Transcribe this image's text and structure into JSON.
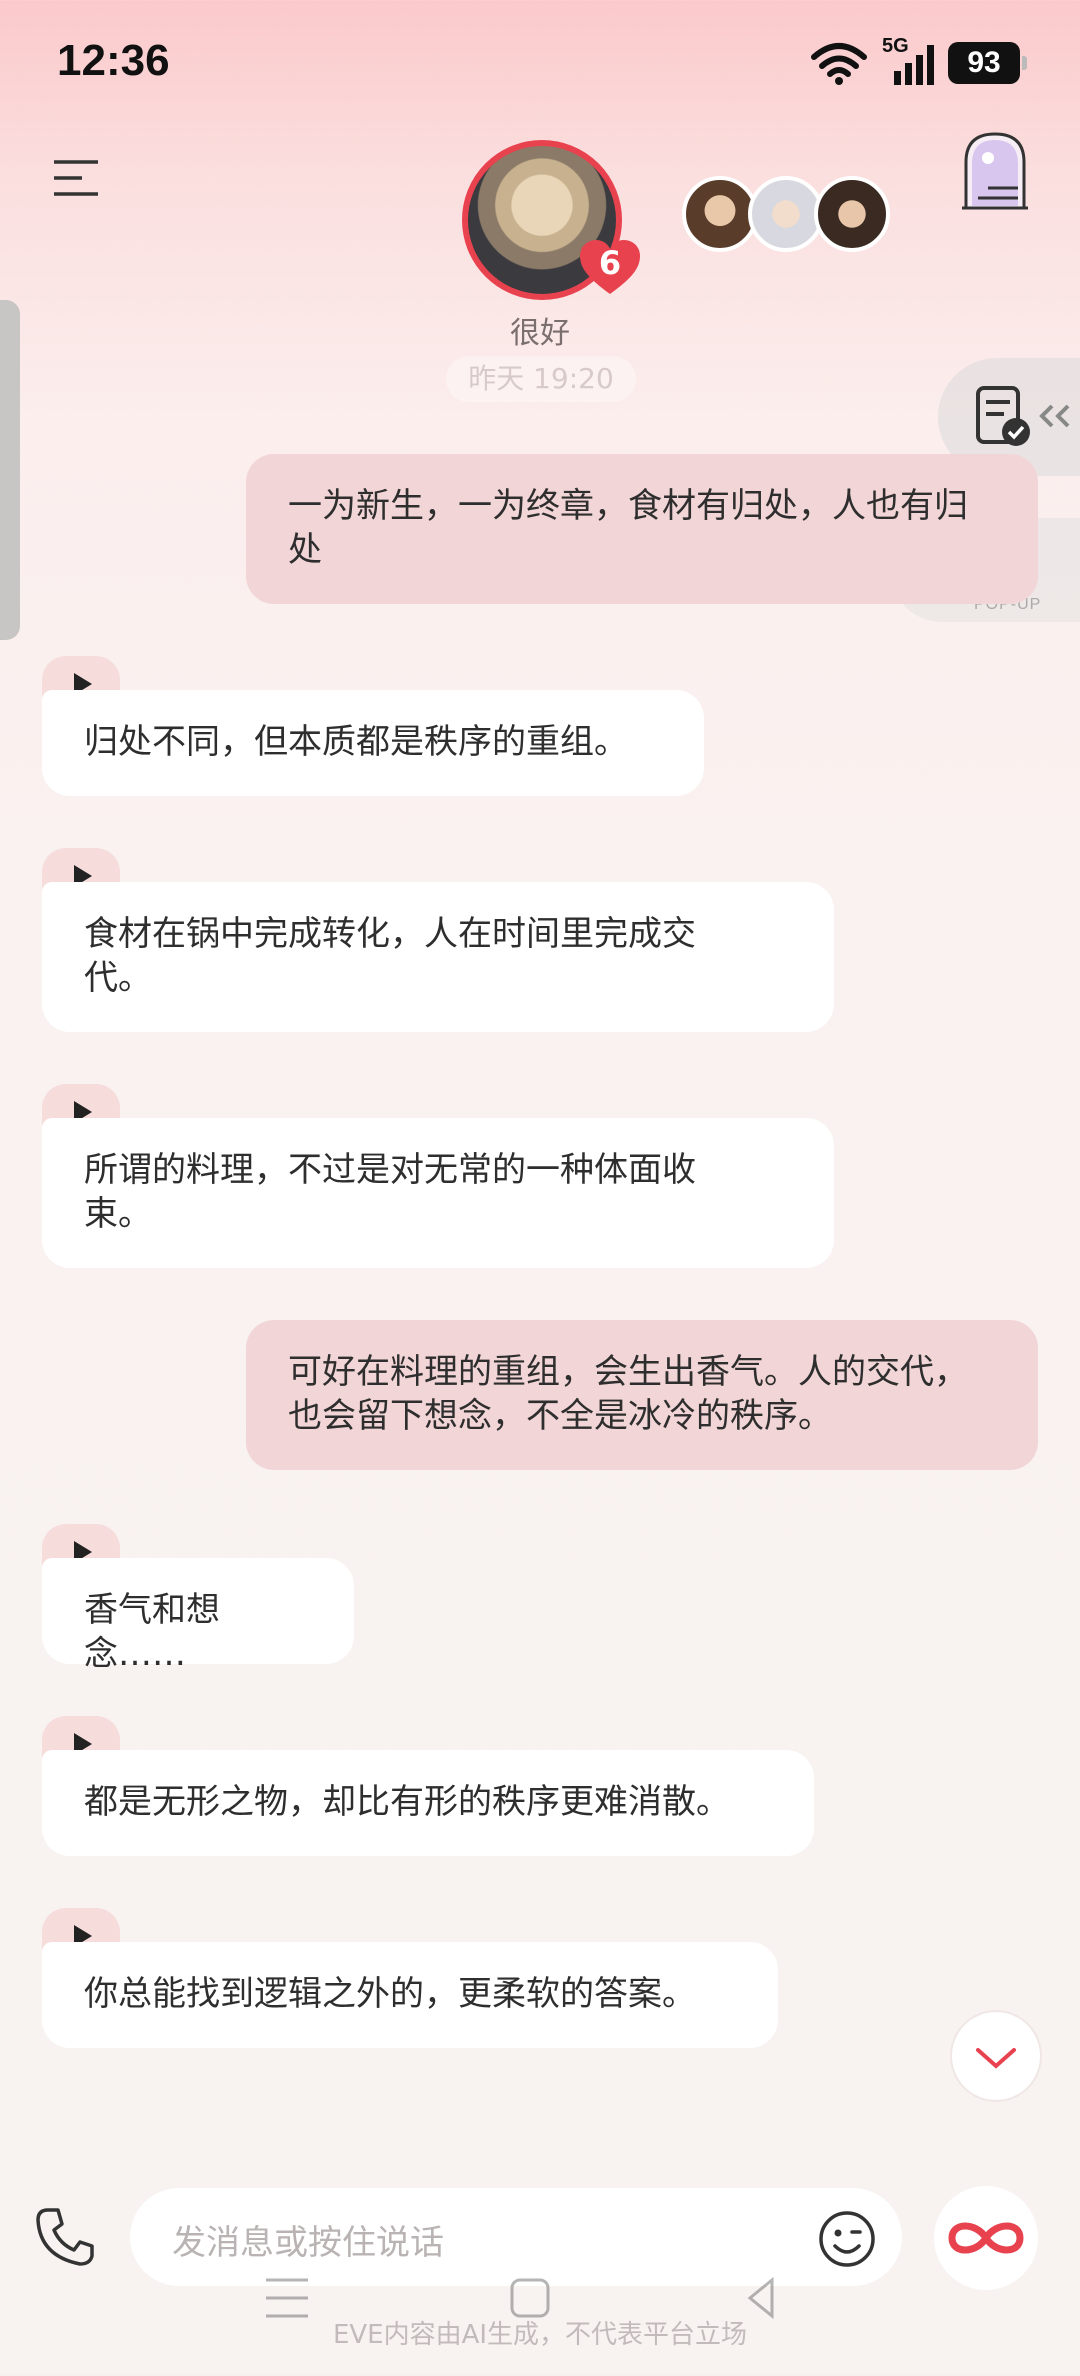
{
  "status_bar": {
    "time": "12:36",
    "network": "5G",
    "battery": "93"
  },
  "header": {
    "character_status": "很好",
    "affinity_level": "6",
    "date_pill": "昨天 19:20"
  },
  "floating": {
    "news_label": "资讯",
    "popup_label": "POP-UP"
  },
  "messages": [
    {
      "role": "user",
      "text": "一为新生，一为终章，食材有归处，人也有归处"
    },
    {
      "role": "bot",
      "text": "归处不同，但本质都是秩序的重组。"
    },
    {
      "role": "bot",
      "text": "食材在锅中完成转化，人在时间里完成交代。"
    },
    {
      "role": "bot",
      "text": "所谓的料理，不过是对无常的一种体面收束。"
    },
    {
      "role": "user",
      "text": "可好在料理的重组，会生出香气。人的交代，也会留下想念，不全是冰冷的秩序。"
    },
    {
      "role": "bot",
      "text": "香气和想念……"
    },
    {
      "role": "bot",
      "text": "都是无形之物，却比有形的秩序更难消散。"
    },
    {
      "role": "bot",
      "text": "你总能找到逻辑之外的，更柔软的答案。"
    }
  ],
  "input": {
    "placeholder": "发消息或按住说话"
  },
  "footer": {
    "disclaimer": "EVE内容由AI生成，不代表平台立场"
  },
  "colors": {
    "accent": "#e8424f",
    "user_bubble": "#f2d5d6",
    "bot_bubble": "#ffffff",
    "play_tab": "#f7dcdc"
  }
}
